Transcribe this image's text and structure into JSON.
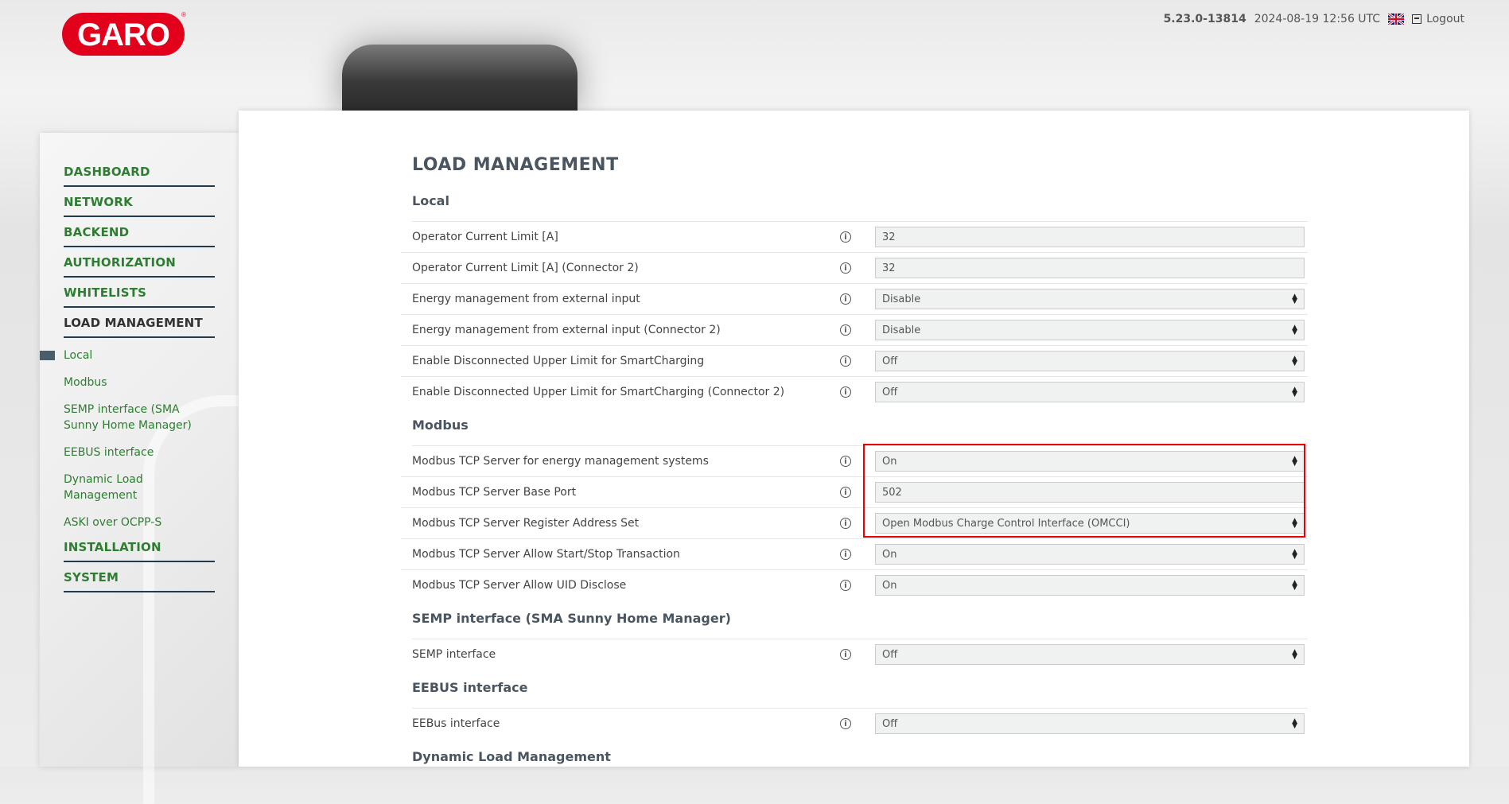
{
  "header": {
    "logo_text": "GARO",
    "version": "5.23.0-13814",
    "datetime": "2024-08-19 12:56 UTC",
    "flag_icon": "uk-flag-icon",
    "logout_label": "Logout"
  },
  "sidebar": {
    "items": [
      {
        "label": "DASHBOARD"
      },
      {
        "label": "NETWORK"
      },
      {
        "label": "BACKEND"
      },
      {
        "label": "AUTHORIZATION"
      },
      {
        "label": "WHITELISTS"
      },
      {
        "label": "LOAD MANAGEMENT"
      }
    ],
    "sub_items": [
      {
        "label": "Local"
      },
      {
        "label": "Modbus"
      },
      {
        "label": "SEMP interface (SMA Sunny Home Manager)"
      },
      {
        "label": "EEBUS interface"
      },
      {
        "label": "Dynamic Load Management"
      },
      {
        "label": "ASKI over OCPP-S"
      }
    ],
    "footer_items": [
      {
        "label": "INSTALLATION"
      },
      {
        "label": "SYSTEM"
      }
    ]
  },
  "main": {
    "title": "LOAD MANAGEMENT",
    "sections": {
      "local": {
        "title": "Local",
        "rows": [
          {
            "label": "Operator Current Limit [A]",
            "value": "32"
          },
          {
            "label": "Operator Current Limit [A] (Connector 2)",
            "value": "32"
          },
          {
            "label": "Energy management from external input",
            "value": "Disable"
          },
          {
            "label": "Energy management from external input (Connector 2)",
            "value": "Disable"
          },
          {
            "label": "Enable Disconnected Upper Limit for SmartCharging",
            "value": "Off"
          },
          {
            "label": "Enable Disconnected Upper Limit for SmartCharging (Connector 2)",
            "value": "Off"
          }
        ]
      },
      "modbus": {
        "title": "Modbus",
        "rows": [
          {
            "label": "Modbus TCP Server for energy management systems",
            "value": "On"
          },
          {
            "label": "Modbus TCP Server Base Port",
            "value": "502"
          },
          {
            "label": "Modbus TCP Server Register Address Set",
            "value": "Open Modbus Charge Control Interface (OMCCI)"
          },
          {
            "label": "Modbus TCP Server Allow Start/Stop Transaction",
            "value": "On"
          },
          {
            "label": "Modbus TCP Server Allow UID Disclose",
            "value": "On"
          }
        ]
      },
      "semp": {
        "title": "SEMP interface (SMA Sunny Home Manager)",
        "rows": [
          {
            "label": "SEMP interface",
            "value": "Off"
          }
        ]
      },
      "eebus": {
        "title": "EEBUS interface",
        "rows": [
          {
            "label": "EEBus interface",
            "value": "Off"
          }
        ]
      },
      "dlm": {
        "title": "Dynamic Load Management"
      }
    }
  },
  "colors": {
    "brand_red": "#e3001b",
    "menu_green": "#2e7d32",
    "highlight_red": "#e00000"
  }
}
